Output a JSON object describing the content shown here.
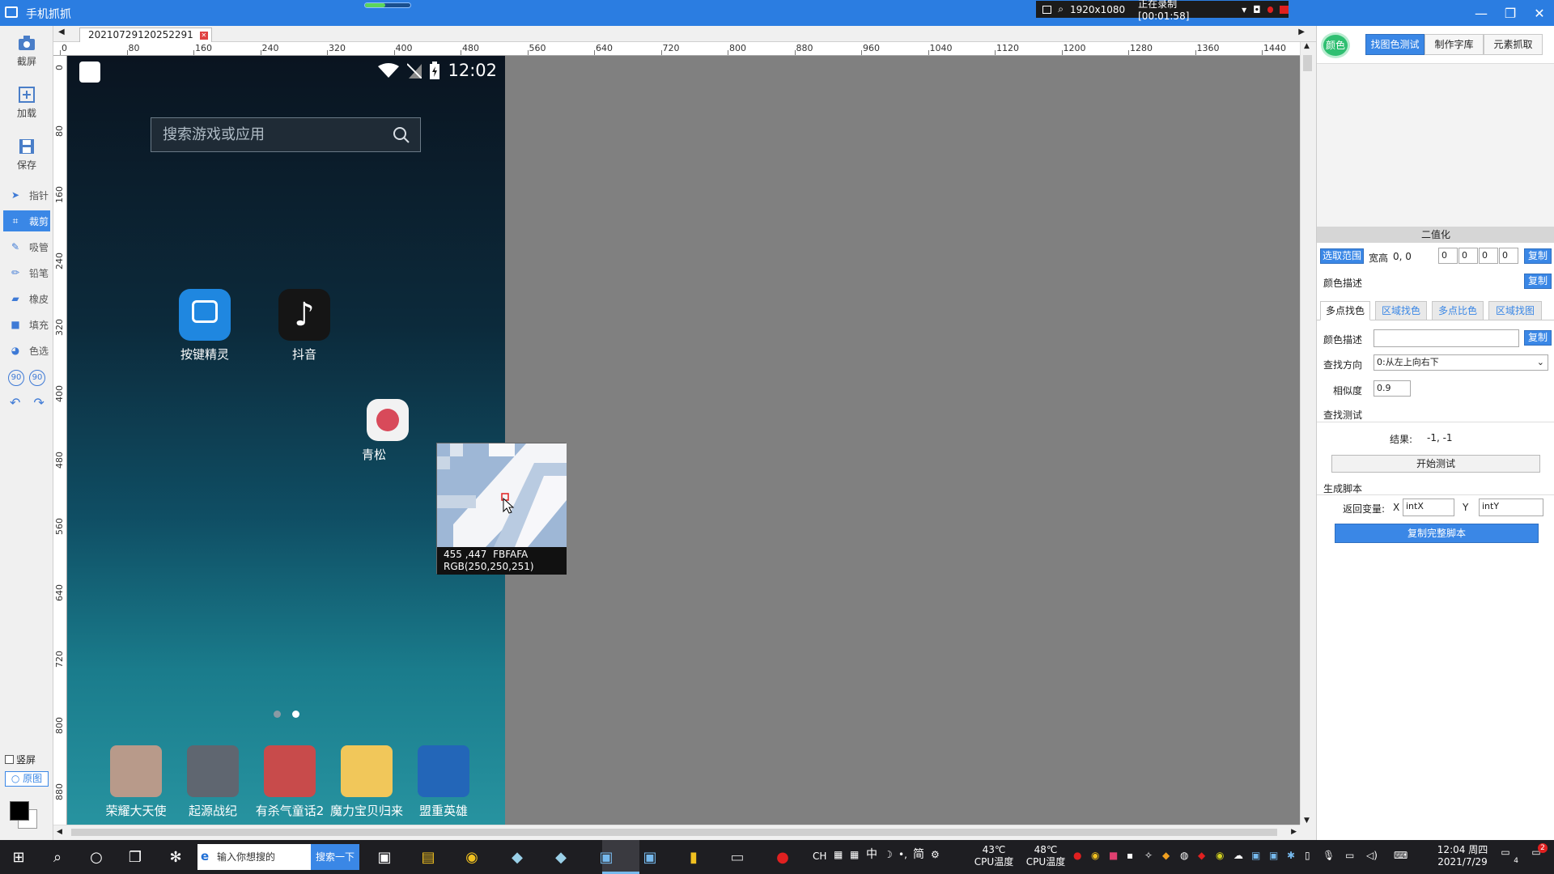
{
  "window": {
    "title": "手机抓抓",
    "recording": {
      "resolution": "1920x1080",
      "status": "正在录制 [00:01:58]"
    }
  },
  "toolbar": {
    "screenshot": "截屏",
    "load": "加载",
    "save": "保存",
    "tools": [
      {
        "label": "指针",
        "icon": "pointer-icon"
      },
      {
        "label": "裁剪",
        "icon": "crop-icon",
        "active": true
      },
      {
        "label": "吸管",
        "icon": "eyedropper-icon"
      },
      {
        "label": "铅笔",
        "icon": "pencil-icon"
      },
      {
        "label": "橡皮",
        "icon": "eraser-icon"
      },
      {
        "label": "填充",
        "icon": "fill-icon"
      },
      {
        "label": "色选",
        "icon": "color-select-icon"
      }
    ],
    "rotate_left": "90",
    "rotate_right": "90",
    "portrait": "竖屏",
    "original": "原图"
  },
  "document": {
    "tab_name": "20210729120252291"
  },
  "rulers": {
    "h_labels": [
      "0",
      "80",
      "160",
      "240",
      "320",
      "400",
      "480",
      "560",
      "640",
      "720",
      "800",
      "880",
      "960",
      "1040",
      "1120",
      "1200",
      "1280",
      "1360",
      "1440"
    ],
    "v_labels": [
      "0",
      "80",
      "160",
      "240",
      "320",
      "400",
      "480",
      "560",
      "640",
      "720",
      "800",
      "880"
    ]
  },
  "phone": {
    "time": "12:02",
    "search_placeholder": "搜索游戏或应用",
    "apps": [
      {
        "label": "按键精灵",
        "color": "#1f87e0"
      },
      {
        "label": "抖音",
        "color": "#151515"
      },
      {
        "label": "青松",
        "color": "#f2f2f2"
      }
    ],
    "dock": [
      {
        "label": "荣耀大天使",
        "color": "#b89a8a"
      },
      {
        "label": "起源战纪",
        "color": "#5f6670"
      },
      {
        "label": "有杀气童话2",
        "color": "#c84b4b"
      },
      {
        "label": "魔力宝贝归来",
        "color": "#f1c75a"
      },
      {
        "label": "盟重英雄",
        "color": "#2366b8"
      }
    ]
  },
  "magnifier": {
    "coords": "455 ,447",
    "hex": "FBFAFA",
    "rgb": "RGB(250,250,251)"
  },
  "panel": {
    "color_button": "颜色",
    "tabs": [
      "找图色测试",
      "制作字库",
      "元素抓取"
    ],
    "active_tab": "找图色测试",
    "binarize_title": "二值化",
    "select_range": "选取范围",
    "wh_label": "宽高",
    "wh_value": "0, 0",
    "range_values": [
      "0",
      "0",
      "0",
      "0"
    ],
    "copy": "复制",
    "color_desc": "颜色描述",
    "sub_tabs": [
      "多点找色",
      "区域找色",
      "多点比色",
      "区域找图"
    ],
    "find_direction_label": "查找方向",
    "find_direction_value": "0:从左上向右下",
    "similarity_label": "相似度",
    "similarity_value": "0.9",
    "find_test": "查找测试",
    "result_label": "结果:",
    "result_value": "-1, -1",
    "start_test": "开始测试",
    "gen_script": "生成脚本",
    "return_var": "返回变量:",
    "x_label": "X",
    "x_value": "intX",
    "y_label": "Y",
    "y_value": "intY",
    "copy_full": "复制完整脚本"
  },
  "taskbar": {
    "search_placeholder": "输入你想搜的",
    "search_button": "搜索一下",
    "tray": {
      "ime": [
        "CH",
        "中",
        "简"
      ],
      "cpu_temp": "43℃",
      "cpu_temp_label": "CPU温度",
      "gpu_temp": "48℃",
      "gpu_temp_label": "CPU温度",
      "time": "12:04 周四",
      "date": "2021/7/29",
      "notify_count": "4",
      "corner_badge": "2"
    }
  }
}
